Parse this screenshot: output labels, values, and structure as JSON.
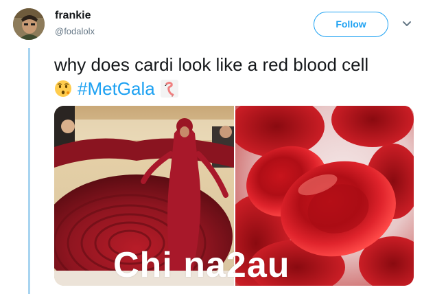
{
  "author": {
    "name": "frankie",
    "handle": "@fodalolx"
  },
  "follow_button": {
    "label": "Follow"
  },
  "tweet": {
    "text": "why does cardi look like a red blood cell",
    "emoji_left": "hushed-kissing-face-emoji",
    "hashtag": "#MetGala",
    "emoji_right": "flamingo-emoji"
  },
  "media": {
    "left_image": "red-gown-photo",
    "right_image": "red-blood-cells-illustration"
  },
  "watermark": {
    "text": "Chi na2au"
  },
  "colors": {
    "accent": "#1da1f2",
    "thread_line": "#a8d4f0",
    "text": "#14171a",
    "secondary_text": "#657786"
  }
}
